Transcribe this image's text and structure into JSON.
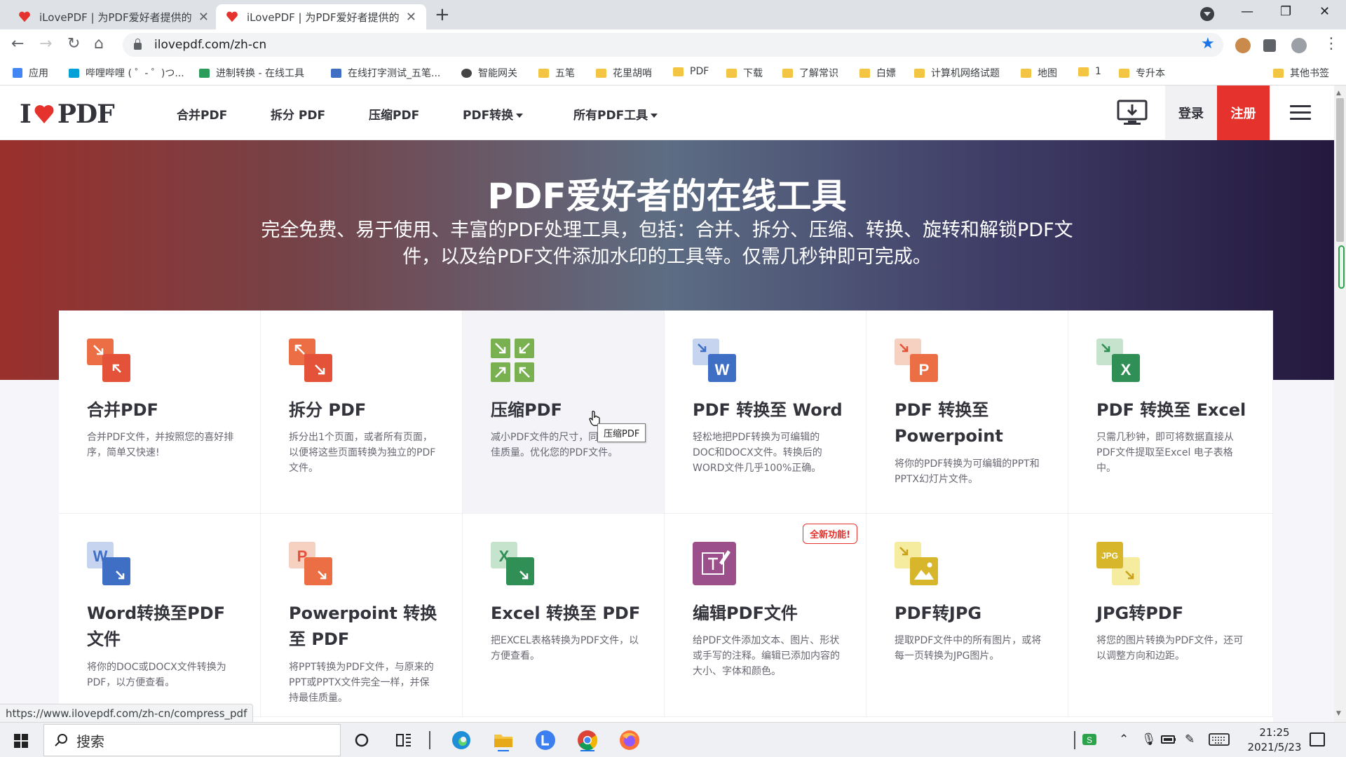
{
  "browser": {
    "tabs": [
      {
        "title": "iLovePDF | 为PDF爱好者提供的PDF文件在线处理工具",
        "active": false
      },
      {
        "title": "iLovePDF | 为PDF爱好者提供的PDF文件在线处理工具",
        "active": true
      }
    ],
    "url": "ilovepdf.com/zh-cn",
    "status_url": "https://www.ilovepdf.com/zh-cn/compress_pdf",
    "bookmarks": [
      "应用",
      "哔哩哔哩 ( ゜- ゜)つ...",
      "进制转换 - 在线工具",
      "在线打字测试_五笔...",
      "智能网关",
      "五笔",
      "花里胡哨",
      "PDF",
      "下载",
      "了解常识",
      "白嫖",
      "计算机网络试题",
      "地图",
      "1",
      "专升本"
    ],
    "bookmarks_other": "其他书签"
  },
  "site": {
    "logo": {
      "left": "I",
      "right": "PDF"
    },
    "nav": [
      {
        "label": "合并PDF",
        "dropdown": false
      },
      {
        "label": "拆分 PDF",
        "dropdown": false
      },
      {
        "label": "压缩PDF",
        "dropdown": false
      },
      {
        "label": "PDF转换",
        "dropdown": true
      },
      {
        "label": "所有PDF工具",
        "dropdown": true
      }
    ],
    "login": "登录",
    "register": "注册",
    "brand_color": "#e5322d"
  },
  "hero": {
    "title": "PDF爱好者的在线工具",
    "subtitle": "完全免费、易于使用、丰富的PDF处理工具，包括：合并、拆分、压缩、转换、旋转和解锁PDF文件，以及给PDF文件添加水印的工具等。仅需几秒钟即可完成。"
  },
  "tools": [
    {
      "title": "合并PDF",
      "desc": "合并PDF文件，并按照您的喜好排序，简单又快速!",
      "icon": "merge-icon",
      "color": "#e5693f"
    },
    {
      "title": "拆分 PDF",
      "desc": "拆分出1个页面，或者所有页面，以便将这些页面转换为独立的PDF文件。",
      "icon": "split-icon",
      "color": "#e5693f"
    },
    {
      "title": "压缩PDF",
      "desc": "减小PDF文件的尺寸，同时保持最佳质量。优化您的PDF文件。",
      "icon": "compress-icon",
      "color": "#6aa84f"
    },
    {
      "title": "PDF 转换至 Word",
      "desc": "轻松地把PDF转换为可编辑的DOC和DOCX文件。转换后的WORD文件几乎100%正确。",
      "icon": "word-icon",
      "color": "#3f6ec5"
    },
    {
      "title": "PDF 转换至 Powerpoint",
      "desc": "将你的PDF转换为可编辑的PPT和PPTX幻灯片文件。",
      "icon": "powerpoint-icon",
      "color": "#ea6a3f"
    },
    {
      "title": "PDF 转换至 Excel",
      "desc": "只需几秒钟，即可将数据直接从PDF文件提取至Excel 电子表格中。",
      "icon": "excel-icon",
      "color": "#2f8f55"
    },
    {
      "title": "Word转换至PDF文件",
      "desc": "将你的DOC或DOCX文件转换为PDF，以方便查看。",
      "icon": "word-to-pdf-icon",
      "color": "#3f6ec5"
    },
    {
      "title": "Powerpoint 转换至 PDF",
      "desc": "将PPT转换为PDF文件，与原来的PPT或PPTX文件完全一样，并保持最佳质量。",
      "icon": "ppt-to-pdf-icon",
      "color": "#ea6a3f"
    },
    {
      "title": "Excel 转换至 PDF",
      "desc": "把EXCEL表格转换为PDF文件，以方便查看。",
      "icon": "excel-to-pdf-icon",
      "color": "#2f8f55"
    },
    {
      "title": "编辑PDF文件",
      "desc": "给PDF文件添加文本、图片、形状或手写的注释。编辑已添加内容的大小、字体和颜色。",
      "icon": "edit-pdf-icon",
      "color": "#9b4f8b",
      "badge": "全新功能!"
    },
    {
      "title": "PDF转JPG",
      "desc": "提取PDF文件中的所有图片，或将每一页转换为JPG图片。",
      "icon": "pdf-to-jpg-icon",
      "color": "#d8b62b"
    },
    {
      "title": "JPG转PDF",
      "desc": "将您的图片转换为PDF文件，还可以调整方向和边距。",
      "icon": "jpg-to-pdf-icon",
      "color": "#d8b62b"
    }
  ],
  "tooltip": "压缩PDF",
  "taskbar": {
    "search_placeholder": "搜索",
    "time": "21:25",
    "date": "2021/5/23"
  }
}
